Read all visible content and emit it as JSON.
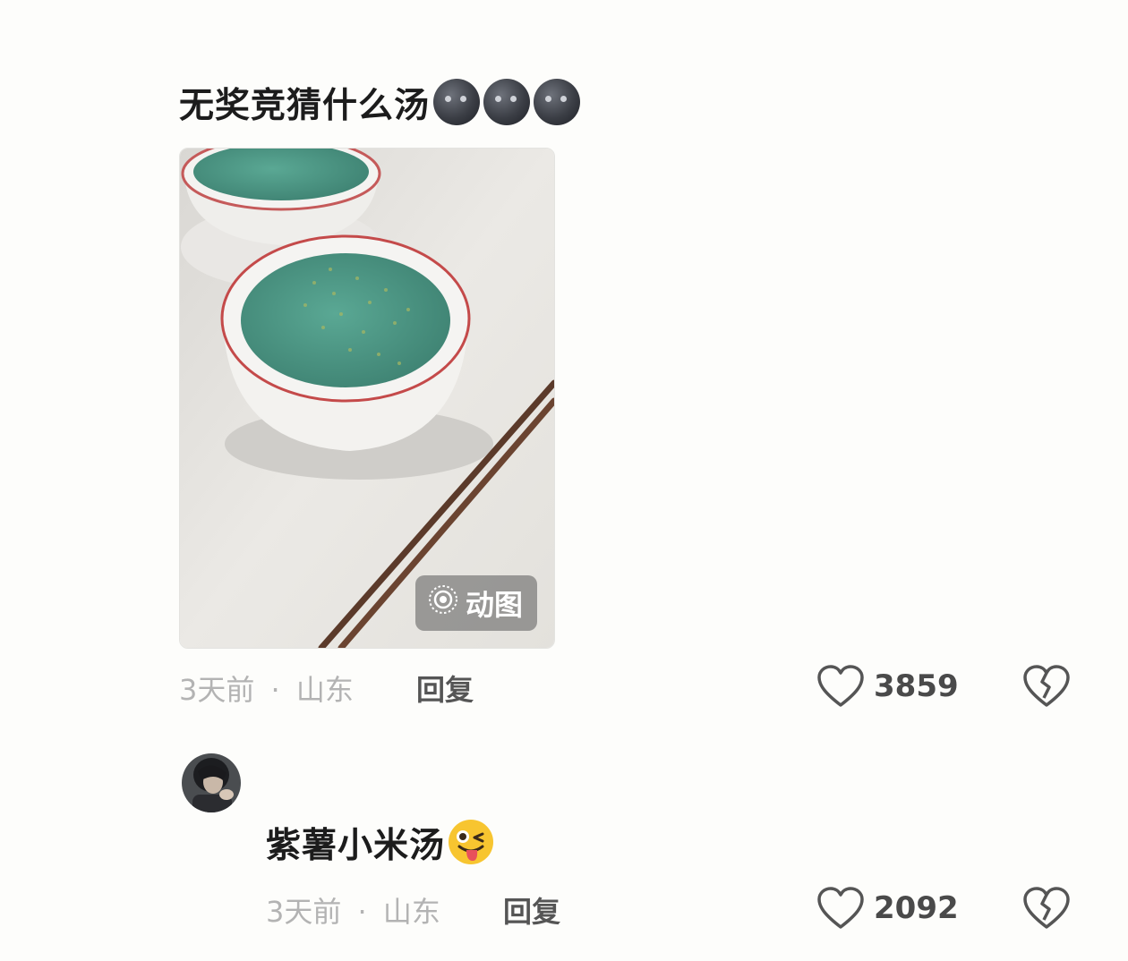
{
  "comment": {
    "text": "无奖竞猜什么汤",
    "emoji_icons": [
      "new-moon-face-icon",
      "new-moon-face-icon",
      "new-moon-face-icon"
    ],
    "image": {
      "badge": "动图"
    },
    "time": "3天前",
    "separator": "·",
    "location": "山东",
    "reply_label": "回复",
    "likes": "3859"
  },
  "reply": {
    "text": "紫薯小米汤",
    "emoji_icon": "winking-face-tongue-icon",
    "time": "3天前",
    "separator": "·",
    "location": "山东",
    "reply_label": "回复",
    "likes": "2092"
  },
  "colors": {
    "background": "#fdfdfb",
    "meta_text": "#b3b3b3",
    "soup": "#4f9a86"
  }
}
